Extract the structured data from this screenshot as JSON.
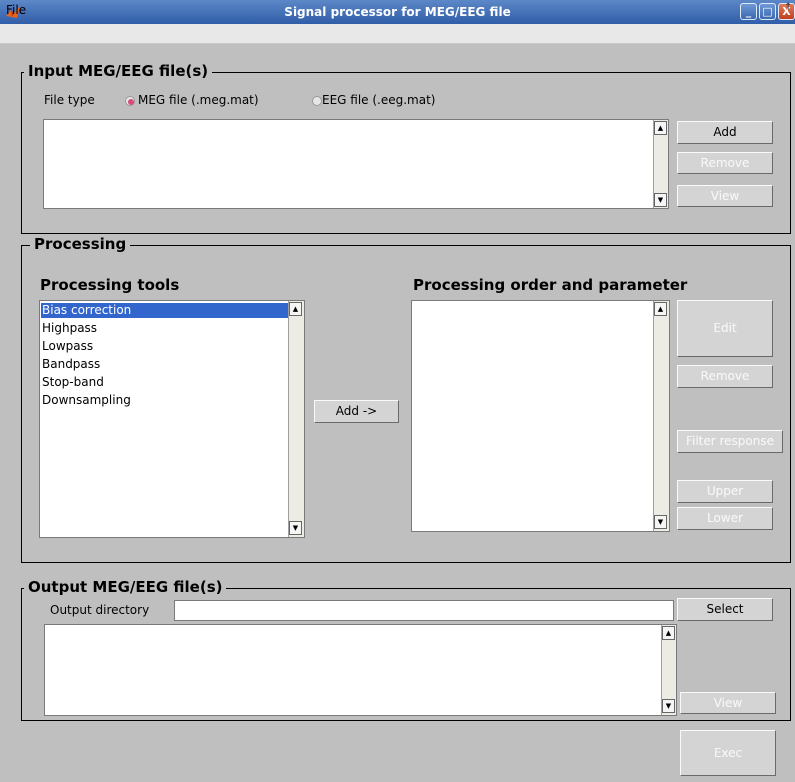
{
  "window": {
    "title": "Signal processor for MEG/EEG file",
    "controls": {
      "minimize": "_",
      "maximize": "□",
      "close": "X"
    }
  },
  "menu": {
    "file": "File",
    "overflow": "↑"
  },
  "input_panel": {
    "title": "Input MEG/EEG file(s)",
    "file_type_label": "File type",
    "options": [
      "MEG file (.meg.mat)",
      "EEG file (.eeg.mat)"
    ],
    "selected_option": "MEG file (.meg.mat)",
    "buttons": {
      "add": "Add",
      "remove": "Remove",
      "view": "View"
    }
  },
  "processing_panel": {
    "title": "Processing",
    "tools_heading": "Processing tools",
    "tools": [
      "Bias correction",
      "Highpass",
      "Lowpass",
      "Bandpass",
      "Stop-band",
      "Downsampling"
    ],
    "selected_tool": "Bias correction",
    "add_button": "Add ->",
    "order_heading": "Processing order and parameter",
    "buttons": {
      "edit": "Edit",
      "remove": "Remove",
      "filter_response": "Filter response",
      "upper": "Upper",
      "lower": "Lower"
    }
  },
  "output_panel": {
    "title": "Output MEG/EEG file(s)",
    "directory_label": "Output directory",
    "directory_value": "",
    "buttons": {
      "select": "Select",
      "view": "View"
    }
  },
  "exec_button": "Exec",
  "colors": {
    "background": "#c0bfbf",
    "title_bar": "#2f5da8",
    "selection": "#3366cc",
    "radio_selected": "#d64b77"
  }
}
